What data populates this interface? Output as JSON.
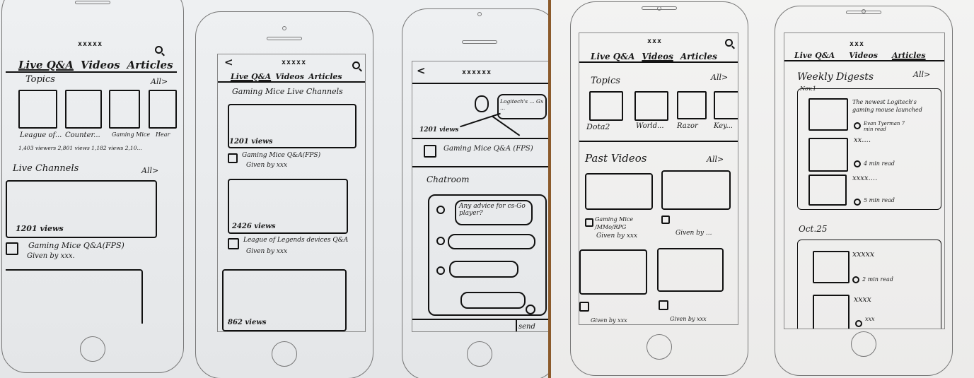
{
  "colors": {
    "ink": "#111111",
    "paper_left": "#e9ebed",
    "paper_right": "#efeeed",
    "gap": "#8b5a2b"
  },
  "header_marks": {
    "s1": "xxxxx",
    "s2": "xxxxx",
    "s3": "xxxxxx",
    "s4": "xxx",
    "s5": "xxx"
  },
  "nav": {
    "live_qa": "Live Q&A",
    "videos": "Videos",
    "articles": "Articles"
  },
  "screen1": {
    "topics": {
      "title": "Topics",
      "all": "All>",
      "labels": [
        "League of...",
        "Counter...",
        "Gaming Mice",
        "Hear"
      ],
      "meta": "1,403 viewers 2,801 views 1,182 views 2,10..."
    },
    "live_channels": {
      "title": "Live Channels",
      "all": "All>",
      "views": "1201 views",
      "item_title": "Gaming Mice Q&A(FPS)",
      "given": "Given by xxx."
    }
  },
  "screen2": {
    "heading": "Gaming Mice Live Channels",
    "c1": {
      "views": "1201 views",
      "title": "Gaming Mice Q&A(FPS)",
      "given": "Given by xxx"
    },
    "c2": {
      "views": "2426 views",
      "title": "League of Legends devices Q&A",
      "given": "Given by xxx"
    },
    "c3": {
      "views": "862 views"
    }
  },
  "screen3": {
    "video_views": "1201 views",
    "video_bubble": "Logitech's ... Gx ...",
    "title": "Gaming Mice Q&A (FPS)",
    "chatroom": "Chatroom",
    "first_msg": "Any advice for cs-Go player?",
    "send": "send"
  },
  "screen4": {
    "topics": {
      "title": "Topics",
      "all": "All>",
      "labels": [
        "Dota2",
        "World...",
        "Razor",
        "Key..."
      ]
    },
    "past_videos": {
      "title": "Past Videos",
      "all": "All>",
      "v1": "Gaming Mice /MMo/RPG",
      "v1_given": "Given by xxx",
      "v2_given": "Given by ...",
      "bottom_given": [
        "Given by xxx",
        "Given by xxx"
      ]
    }
  },
  "screen5": {
    "weekly": "Weekly Digests",
    "all": "All>",
    "date1": "Nov.1",
    "article_title": "The newest Logitech's gaming mouse launched",
    "author": "Evan Tyerman 7 min read",
    "a2_title": "xx....",
    "a2_read": "4 min read",
    "a3_title": "xxxx....",
    "a3_read": "5 min read",
    "date2": "Oct.25",
    "b1_title": "xxxxx",
    "b1_read": "2 min read",
    "b2_title": "xxxx",
    "b2_read": "xxx"
  }
}
